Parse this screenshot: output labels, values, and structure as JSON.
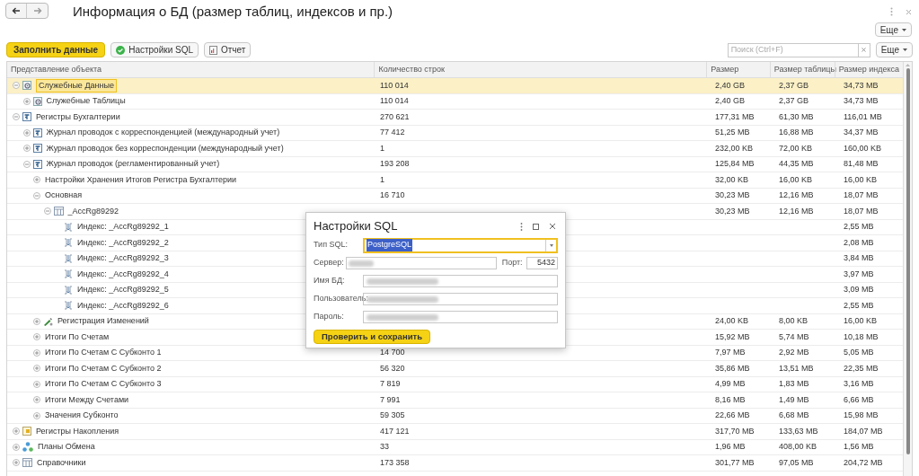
{
  "window": {
    "title": "Информация о БД (размер таблиц, индексов и пр.)",
    "menu_more": "Еще"
  },
  "toolbar": {
    "fill_button": "Заполнить данные",
    "sql_button": "Настройки SQL",
    "report_button": "Отчет",
    "search": {
      "placeholder": "Поиск (Ctrl+F)"
    },
    "more_button": "Еще"
  },
  "table": {
    "columns": [
      "Представление объекта",
      "Количество строк",
      "Размер",
      "Размер таблицы",
      "Размер индекса"
    ],
    "rows": [
      {
        "name": "Служебные Данные",
        "kind": "service",
        "expanded": true,
        "selected": true,
        "count": "110 014",
        "size": "2,40 GB",
        "table_size": "2,37 GB",
        "index_size": "34,73 MB",
        "children": [
          {
            "name": "Служебные Таблицы",
            "kind": "service",
            "expanded": false,
            "selected": false,
            "count": "110 014",
            "size": "2,40 GB",
            "table_size": "2,37 GB",
            "index_size": "34,73 MB"
          }
        ]
      },
      {
        "name": "Регистры Бухгалтерии",
        "kind": "register",
        "expanded": true,
        "selected": false,
        "count": "270 621",
        "size": "177,31 MB",
        "table_size": "61,30 MB",
        "index_size": "116,01 MB",
        "children": [
          {
            "name": "Журнал проводок с корреспонденцией (международный учет)",
            "kind": "register",
            "expanded": false,
            "selected": false,
            "count": "77 412",
            "size": "51,25 MB",
            "table_size": "16,88 MB",
            "index_size": "34,37 MB"
          },
          {
            "name": "Журнал проводок без корреспонденции (международный учет)",
            "kind": "register",
            "expanded": false,
            "selected": false,
            "count": "1",
            "size": "232,00 KB",
            "table_size": "72,00 KB",
            "index_size": "160,00 KB"
          },
          {
            "name": "Журнал проводок (регламентированный учет)",
            "kind": "register",
            "expanded": true,
            "selected": false,
            "count": "193 208",
            "size": "125,84 MB",
            "table_size": "44,35 MB",
            "index_size": "81,48 MB",
            "children": [
              {
                "name": "Настройки Хранения Итогов Регистра Бухгалтерии",
                "kind": "plain",
                "expanded": false,
                "selected": false,
                "count": "1",
                "size": "32,00 KB",
                "table_size": "16,00 KB",
                "index_size": "16,00 KB"
              },
              {
                "name": "Основная",
                "kind": "plain",
                "expanded": true,
                "selected": false,
                "count": "16 710",
                "size": "30,23 MB",
                "table_size": "12,16 MB",
                "index_size": "18,07 MB",
                "children": [
                  {
                    "name": "_AccRg89292",
                    "kind": "table",
                    "expanded": true,
                    "selected": false,
                    "size": "30,23 MB",
                    "table_size": "12,16 MB",
                    "index_size": "18,07 MB",
                    "children": [
                      {
                        "name": "Индекс: _AccRg89292_1",
                        "kind": "index",
                        "selected": false,
                        "index_size": "2,55 MB"
                      },
                      {
                        "name": "Индекс: _AccRg89292_2",
                        "kind": "index",
                        "selected": false,
                        "index_size": "2,08 MB"
                      },
                      {
                        "name": "Индекс: _AccRg89292_3",
                        "kind": "index",
                        "selected": false,
                        "index_size": "3,84 MB"
                      },
                      {
                        "name": "Индекс: _AccRg89292_4",
                        "kind": "index",
                        "selected": false,
                        "index_size": "3,97 MB"
                      },
                      {
                        "name": "Индекс: _AccRg89292_5",
                        "kind": "index",
                        "selected": false,
                        "index_size": "3,09 MB"
                      },
                      {
                        "name": "Индекс: _AccRg89292_6",
                        "kind": "index",
                        "selected": false,
                        "index_size": "2,55 MB"
                      }
                    ]
                  }
                ]
              },
              {
                "name": "Регистрация Изменений",
                "kind": "exchange",
                "expanded": false,
                "selected": false,
                "size": "24,00 KB",
                "table_size": "8,00 KB",
                "index_size": "16,00 KB"
              },
              {
                "name": "Итоги По Счетам",
                "kind": "plain",
                "expanded": false,
                "selected": false,
                "size": "15,92 MB",
                "table_size": "5,74 MB",
                "index_size": "10,18 MB"
              },
              {
                "name": "Итоги По Счетам С Субконто 1",
                "kind": "plain",
                "expanded": false,
                "selected": false,
                "count": "14 700",
                "size": "7,97 MB",
                "table_size": "2,92 MB",
                "index_size": "5,05 MB"
              },
              {
                "name": "Итоги По Счетам С Субконто 2",
                "kind": "plain",
                "expanded": false,
                "selected": false,
                "count": "56 320",
                "size": "35,86 MB",
                "table_size": "13,51 MB",
                "index_size": "22,35 MB"
              },
              {
                "name": "Итоги По Счетам С Субконто 3",
                "kind": "plain",
                "expanded": false,
                "selected": false,
                "count": "7 819",
                "size": "4,99 MB",
                "table_size": "1,83 MB",
                "index_size": "3,16 MB"
              },
              {
                "name": "Итоги Между Счетами",
                "kind": "plain",
                "expanded": false,
                "selected": false,
                "count": "7 991",
                "size": "8,16 MB",
                "table_size": "1,49 MB",
                "index_size": "6,66 MB"
              },
              {
                "name": "Значения Субконто",
                "kind": "plain",
                "expanded": false,
                "selected": false,
                "count": "59 305",
                "size": "22,66 MB",
                "table_size": "6,68 MB",
                "index_size": "15,98 MB"
              }
            ]
          }
        ]
      },
      {
        "name": "Регистры Накопления",
        "kind": "accumulation",
        "expanded": false,
        "selected": false,
        "count": "417 121",
        "size": "317,70 MB",
        "table_size": "133,63 MB",
        "index_size": "184,07 MB"
      },
      {
        "name": "Планы Обмена",
        "kind": "exchange-plan",
        "expanded": false,
        "selected": false,
        "count": "33",
        "size": "1,96 MB",
        "table_size": "408,00 KB",
        "index_size": "1,56 MB"
      },
      {
        "name": "Справочники",
        "kind": "table",
        "expanded": false,
        "selected": false,
        "count": "173 358",
        "size": "301,77 MB",
        "table_size": "97,05 MB",
        "index_size": "204,72 MB"
      }
    ]
  },
  "dialog": {
    "title": "Настройки SQL",
    "fields": [
      {
        "kind": "select",
        "label": "Тип SQL:",
        "value": "PostgreSQL",
        "focused": true
      },
      {
        "kind": "server",
        "label": "Сервер:",
        "redacted": true,
        "port_label": "Порт:",
        "port": "5432"
      },
      {
        "kind": "text",
        "label": "Имя БД:",
        "redacted": true
      },
      {
        "kind": "text",
        "label": "Пользователь:",
        "redacted": true
      },
      {
        "kind": "text",
        "label": "Пароль:",
        "redacted": true
      }
    ],
    "button": "Проверить и сохранить"
  }
}
